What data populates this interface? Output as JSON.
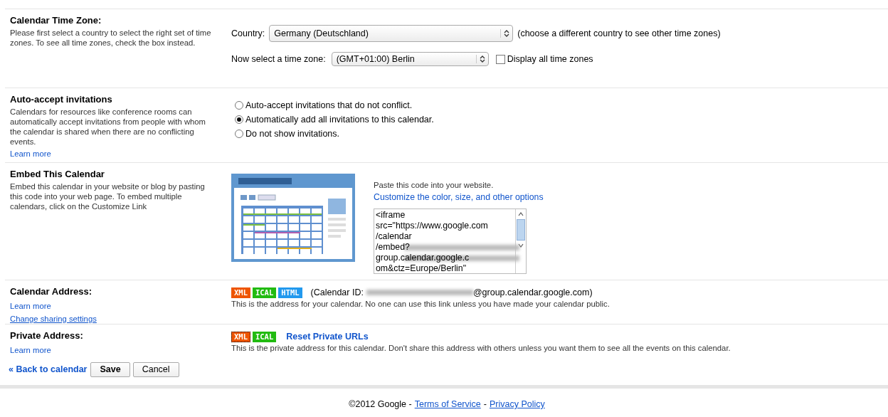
{
  "sections": [
    {
      "kind": "timezone",
      "title": "Calendar Time Zone:",
      "description": "Please first select a country to select the right set of time zones. To see all time zones, check the box instead.",
      "country_label": "Country:",
      "country_value": "Germany (Deutschland)",
      "country_hint": "(choose a different country to see other time zones)",
      "zone_label": "Now select a time zone:",
      "zone_value": "(GMT+01:00) Berlin",
      "show_all": {
        "label": "Display all time zones",
        "checked": false
      }
    },
    {
      "kind": "invitations",
      "title": "Auto-accept invitations",
      "description": "Calendars for resources like conference rooms can automatically accept invitations from people with whom the calendar is shared when there are no conflicting events.",
      "links": [
        {
          "text": "Learn more",
          "underline": false
        }
      ],
      "options": [
        {
          "label": "Auto-accept invitations that do not conflict.",
          "selected": false
        },
        {
          "label": "Automatically add all invitations to this calendar.",
          "selected": true
        },
        {
          "label": "Do not show invitations.",
          "selected": false
        }
      ]
    },
    {
      "kind": "embed",
      "title": "Embed This Calendar",
      "description": "Embed this calendar in your website or blog by pasting this code into your web page. To embed multiple calendars, click on the Customize Link",
      "instruction": "Paste this code into your website.",
      "customize_link": "Customize the color, size, and other options",
      "code_lines": [
        {
          "text": "<iframe",
          "blurred": false
        },
        {
          "text": "src=\"https://www.google.com",
          "blurred": false
        },
        {
          "text": "/calendar",
          "blurred": false
        },
        {
          "text": "/embed?",
          "blurred": true
        },
        {
          "text": "group.calendar.google.c",
          "blurred": true
        },
        {
          "text": "om&ctz=Europe/Berlin\"",
          "blurred": false
        }
      ]
    },
    {
      "kind": "address",
      "title": "Calendar Address:",
      "links": [
        {
          "text": "Learn more",
          "underline": false
        },
        {
          "text": "Change sharing settings",
          "underline": true
        }
      ],
      "badges": [
        {
          "label": "XML",
          "color": "#ee5500",
          "focused": false
        },
        {
          "label": "ICAL",
          "color": "#22bb11",
          "focused": false
        },
        {
          "label": "HTML",
          "color": "#2299ee",
          "focused": false
        }
      ],
      "id_prefix": "(Calendar ID:",
      "id_suffix": "@group.calendar.google.com)",
      "note": "This is the address for your calendar. No one can use this link unless you have made your calendar public."
    },
    {
      "kind": "address",
      "title": "Private Address:",
      "links": [
        {
          "text": "Learn more",
          "underline": false
        }
      ],
      "badges": [
        {
          "label": "XML",
          "color": "#ee5500",
          "focused": true
        },
        {
          "label": "ICAL",
          "color": "#22bb11",
          "focused": false
        }
      ],
      "reset_link": "Reset Private URLs",
      "note": "This is the private address for this calendar. Don't share this address with others unless you want them to see all the events on this calendar."
    }
  ],
  "actions": {
    "back": "« Back to calendar",
    "save": "Save",
    "cancel": "Cancel"
  },
  "footer": {
    "copyright": "©2012 Google -",
    "terms": "Terms of Service",
    "separator": "-",
    "privacy": "Privacy Policy"
  }
}
